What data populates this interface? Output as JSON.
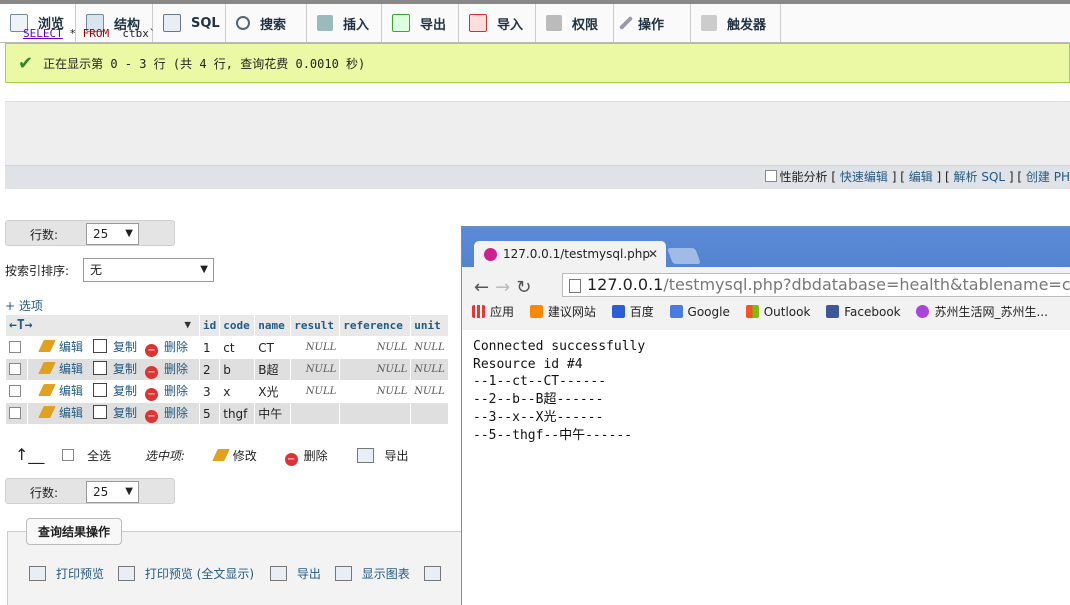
{
  "tabs": [
    {
      "label": "浏览",
      "icon": "browse-icon",
      "active": true
    },
    {
      "label": "结构",
      "icon": "structure-icon"
    },
    {
      "label": "SQL",
      "icon": "sql-icon"
    },
    {
      "label": "搜索",
      "icon": "search-icon"
    },
    {
      "label": "插入",
      "icon": "insert-icon"
    },
    {
      "label": "导出",
      "icon": "export-icon"
    },
    {
      "label": "导入",
      "icon": "import-icon"
    },
    {
      "label": "权限",
      "icon": "privileges-icon"
    },
    {
      "label": "操作",
      "icon": "operations-icon"
    },
    {
      "label": "触发器",
      "icon": "triggers-icon"
    }
  ],
  "success_message": "正在显示第 0 - 3 行 (共 4 行, 查询花费 0.0010 秒)",
  "sql": {
    "select": "SELECT",
    "star": " * ",
    "from": "FROM",
    "table": " `ctbx`"
  },
  "sql_links": {
    "profiling": "性能分析",
    "inline_edit": "快速编辑",
    "edit": "编辑",
    "explain": "解析 SQL",
    "create": "创建 PH"
  },
  "rows_label": "行数:",
  "rows_value": "25",
  "sort_label": "按索引排序:",
  "sort_value": "无",
  "options_link": "+ 选项",
  "table": {
    "columns": [
      "id",
      "code",
      "name",
      "result",
      "reference",
      "unit"
    ],
    "actions": {
      "edit": "编辑",
      "copy": "复制",
      "delete": "删除"
    },
    "rows": [
      {
        "id": "1",
        "code": "ct",
        "name": "CT",
        "result": "NULL",
        "reference": "NULL",
        "unit": "NULL"
      },
      {
        "id": "2",
        "code": "b",
        "name": "B超",
        "result": "NULL",
        "reference": "NULL",
        "unit": "NULL"
      },
      {
        "id": "3",
        "code": "x",
        "name": "X光",
        "result": "NULL",
        "reference": "NULL",
        "unit": "NULL"
      },
      {
        "id": "5",
        "code": "thgf",
        "name": "中午",
        "result": "",
        "reference": "",
        "unit": ""
      }
    ]
  },
  "bulk": {
    "select_all": "全选",
    "selected": "选中项:",
    "edit": "修改",
    "delete": "删除",
    "export": "导出"
  },
  "query_results": {
    "title": "查询结果操作",
    "print": "打印预览",
    "print_full": "打印预览 (全文显示)",
    "export": "导出",
    "chart": "显示图表"
  },
  "browser": {
    "tab_title": "127.0.0.1/testmysql.php",
    "url_host": "127.0.0.1",
    "url_rest": "/testmysql.php?dbdatabase=health&tablename=ctbx",
    "bookmarks": [
      "应用",
      "建议网站",
      "百度",
      "Google",
      "Outlook",
      "Facebook",
      "苏州生活网_苏州生..."
    ],
    "content_lines": [
      "Connected successfully",
      "Resource id #4",
      "--1--ct--CT------",
      "--2--b--B超------",
      "--3--x--X光------",
      "--5--thgf--中午------"
    ]
  },
  "colors": {
    "success_bg": "#ebf8a4",
    "link": "#235a81",
    "browser_chrome": "#4a7bc8"
  }
}
